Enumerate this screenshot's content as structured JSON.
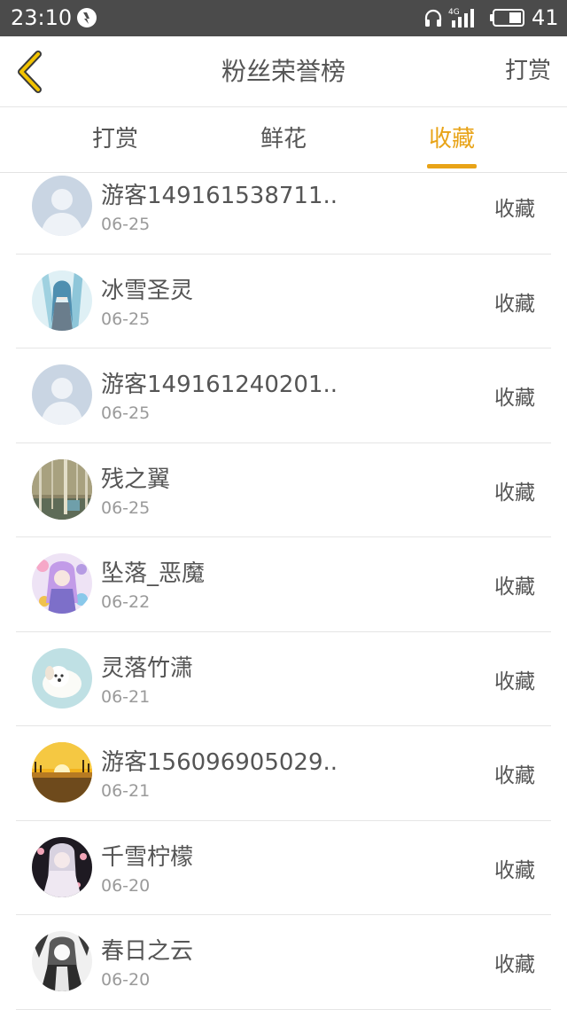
{
  "status_bar": {
    "time": "23:10",
    "network": "4G",
    "battery": "41"
  },
  "header": {
    "title": "粉丝荣誉榜",
    "right_action": "打赏",
    "back_icon": "chevron-left-icon"
  },
  "tabs": [
    {
      "label": "打赏",
      "active": false
    },
    {
      "label": "鲜花",
      "active": false
    },
    {
      "label": "收藏",
      "active": true
    }
  ],
  "colors": {
    "accent": "#e8a317",
    "status_bar": "#4b4b4b",
    "text": "#555555",
    "muted": "#9a9a9a"
  },
  "fans": [
    {
      "name": "游客149161538711..",
      "date": "06-25",
      "action": "收藏",
      "avatar": "default-avatar"
    },
    {
      "name": "冰雪圣灵",
      "date": "06-25",
      "action": "收藏",
      "avatar": "anime-blue"
    },
    {
      "name": "游客149161240201..",
      "date": "06-25",
      "action": "收藏",
      "avatar": "default-avatar"
    },
    {
      "name": "残之翼",
      "date": "06-25",
      "action": "收藏",
      "avatar": "forest"
    },
    {
      "name": "坠落_恶魔",
      "date": "06-22",
      "action": "收藏",
      "avatar": "anime-purple"
    },
    {
      "name": "灵落竹潇",
      "date": "06-21",
      "action": "收藏",
      "avatar": "white-puppy"
    },
    {
      "name": "游客156096905029..",
      "date": "06-21",
      "action": "收藏",
      "avatar": "sunset"
    },
    {
      "name": "千雪柠檬",
      "date": "06-20",
      "action": "收藏",
      "avatar": "anime-dark"
    },
    {
      "name": "春日之云",
      "date": "06-20",
      "action": "收藏",
      "avatar": "anime-bw"
    }
  ]
}
